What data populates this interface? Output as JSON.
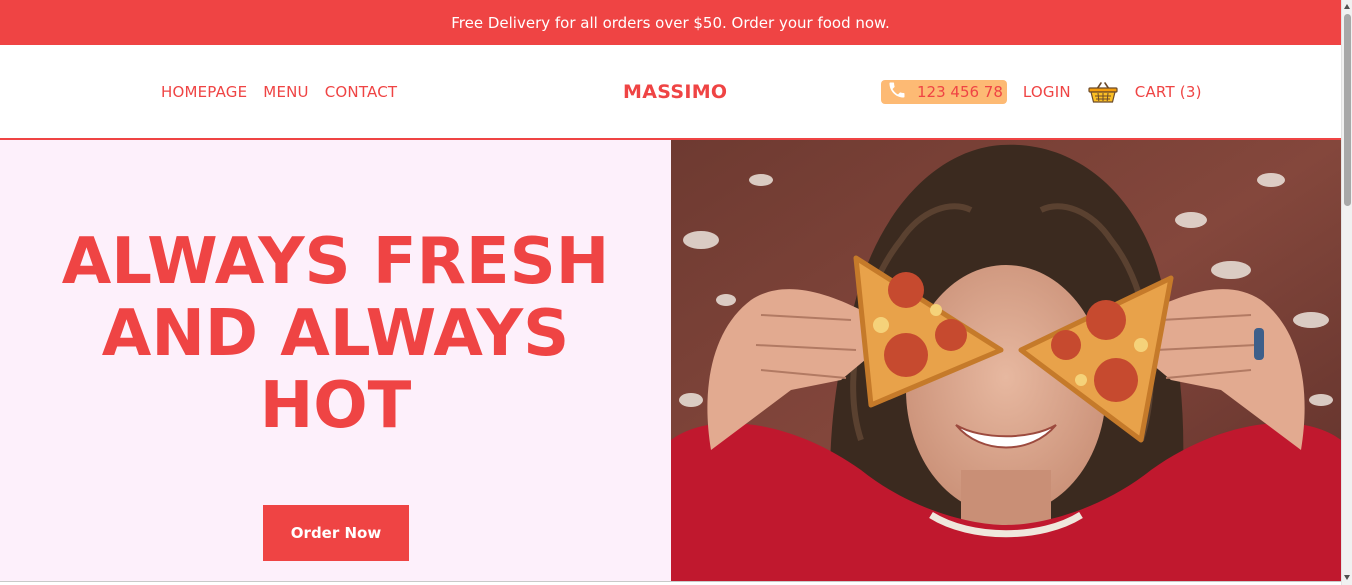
{
  "promo": {
    "text": "Free Delivery for all orders over $50. Order your food now."
  },
  "nav": {
    "links": [
      "HOMEPAGE",
      "MENU",
      "CONTACT"
    ],
    "logo": "MASSIMO",
    "phone": "123 456 78",
    "login": "LOGIN",
    "cart": "CART (3)"
  },
  "hero": {
    "title_lines": [
      "ALWAYS FRESH",
      "AND ALWAYS",
      "HOT"
    ],
    "cta": "Order Now"
  },
  "colors": {
    "accent": "#ef4444",
    "hero_bg": "#fdf0fb",
    "phone_badge": "#fdba74"
  },
  "icons": {
    "phone": "phone-icon",
    "cart": "basket-icon",
    "hero_image": "person-with-pizza-photo"
  }
}
